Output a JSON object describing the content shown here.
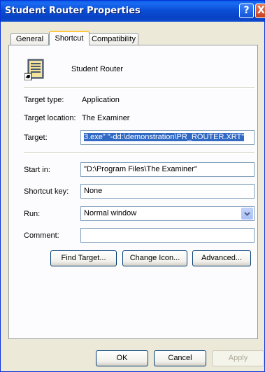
{
  "window": {
    "title": "Student Router Properties",
    "help_glyph": "?",
    "close_glyph": "X"
  },
  "tabs": [
    {
      "label": "General"
    },
    {
      "label": "Shortcut"
    },
    {
      "label": "Compatibility"
    }
  ],
  "header": {
    "name": "Student Router"
  },
  "info": {
    "target_type_label": "Target type:",
    "target_type_value": "Application",
    "target_location_label": "Target location:",
    "target_location_value": "The Examiner"
  },
  "fields": {
    "target_label": "Target:",
    "target_value": "3.exe\" \"-dd:\\demonstration\\PR_ROUTER.XRT\"",
    "start_in_label": "Start in:",
    "start_in_value": "\"D:\\Program Files\\The Examiner\"",
    "shortcut_key_label": "Shortcut key:",
    "shortcut_key_value": "None",
    "run_label": "Run:",
    "run_value": "Normal window",
    "comment_label": "Comment:",
    "comment_value": ""
  },
  "buttons": {
    "find_target": "Find Target...",
    "change_icon": "Change Icon...",
    "advanced": "Advanced..."
  },
  "footer": {
    "ok": "OK",
    "cancel": "Cancel",
    "apply": "Apply"
  },
  "colors": {
    "titlebar": "#0a4fd6",
    "selection": "#316ac5",
    "tab_highlight": "#ffc83c",
    "dialog_bg": "#ece9d8"
  }
}
